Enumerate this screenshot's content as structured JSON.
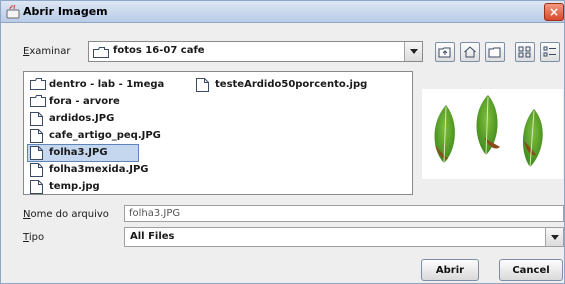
{
  "window": {
    "title": "Abrir Imagem",
    "close_label": "×"
  },
  "lookin": {
    "label_underlined": "E",
    "label_rest": "xaminar",
    "value": "fotos 16-07 cafe"
  },
  "toolbar": {
    "icons": [
      "up-one-level-icon",
      "home-icon",
      "new-folder-icon",
      "list-view-icon",
      "details-view-icon"
    ]
  },
  "files": [
    {
      "name": "dentro - lab - 1mega",
      "kind": "folder",
      "selected": false
    },
    {
      "name": "fora - arvore",
      "kind": "folder",
      "selected": false
    },
    {
      "name": "ardidos.JPG",
      "kind": "file",
      "selected": false
    },
    {
      "name": "cafe_artigo_peq.JPG",
      "kind": "file",
      "selected": false
    },
    {
      "name": "folha3.JPG",
      "kind": "file",
      "selected": true
    },
    {
      "name": "folha3mexida.JPG",
      "kind": "file",
      "selected": false
    },
    {
      "name": "temp.jpg",
      "kind": "file",
      "selected": false
    },
    {
      "name": "testeArdido50porcento.jpg",
      "kind": "file",
      "selected": false
    }
  ],
  "filename": {
    "label_underlined": "N",
    "label_rest": "ome do arquivo",
    "value": "folha3.JPG"
  },
  "filetype": {
    "label_underlined": "T",
    "label_rest": "ipo",
    "value": "All Files"
  },
  "buttons": {
    "open_label": "Abrir",
    "cancel_label": "Cancel"
  },
  "colors": {
    "selection": "#c4d7ef",
    "leaf_green": "#3f8a1e",
    "leaf_brown": "#8a4a1c"
  }
}
